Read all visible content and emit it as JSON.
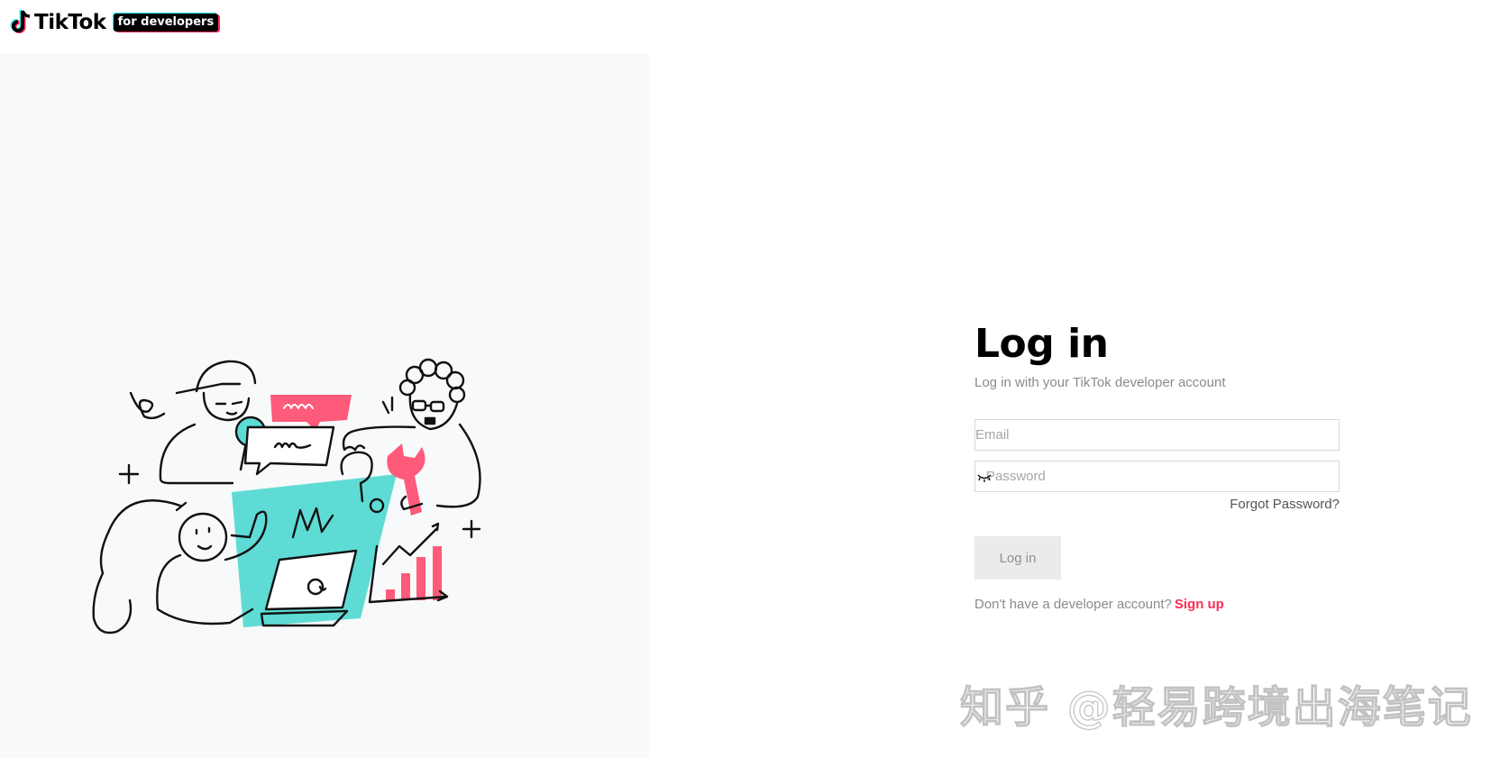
{
  "header": {
    "brand": "TikTok",
    "badge": "for developers",
    "icon": "tiktok-note-icon"
  },
  "illustration": {
    "icons": [
      "developers-illustration",
      "magnifier-icon",
      "chat-bubble-icon",
      "question-mark-icon",
      "wrench-icon",
      "laptop-icon",
      "bar-chart-icon",
      "sparkle-icon"
    ],
    "colors": {
      "teal": "#5fdbd5",
      "pink": "#fe5a7a",
      "ink": "#111111"
    }
  },
  "login": {
    "title": "Log in",
    "subtitle": "Log in with your TikTok developer account",
    "email_placeholder": "Email",
    "password_placeholder": "Password",
    "forgot": "Forgot Password?",
    "button": "Log in",
    "signup_prompt": "Don't have a developer account?",
    "signup_link": "Sign up"
  },
  "watermark": "知乎 @轻易跨境出海笔记",
  "colors": {
    "accent": "#fe2c55",
    "panel_bg": "#f8f9fa",
    "button_bg": "#ebebeb"
  }
}
